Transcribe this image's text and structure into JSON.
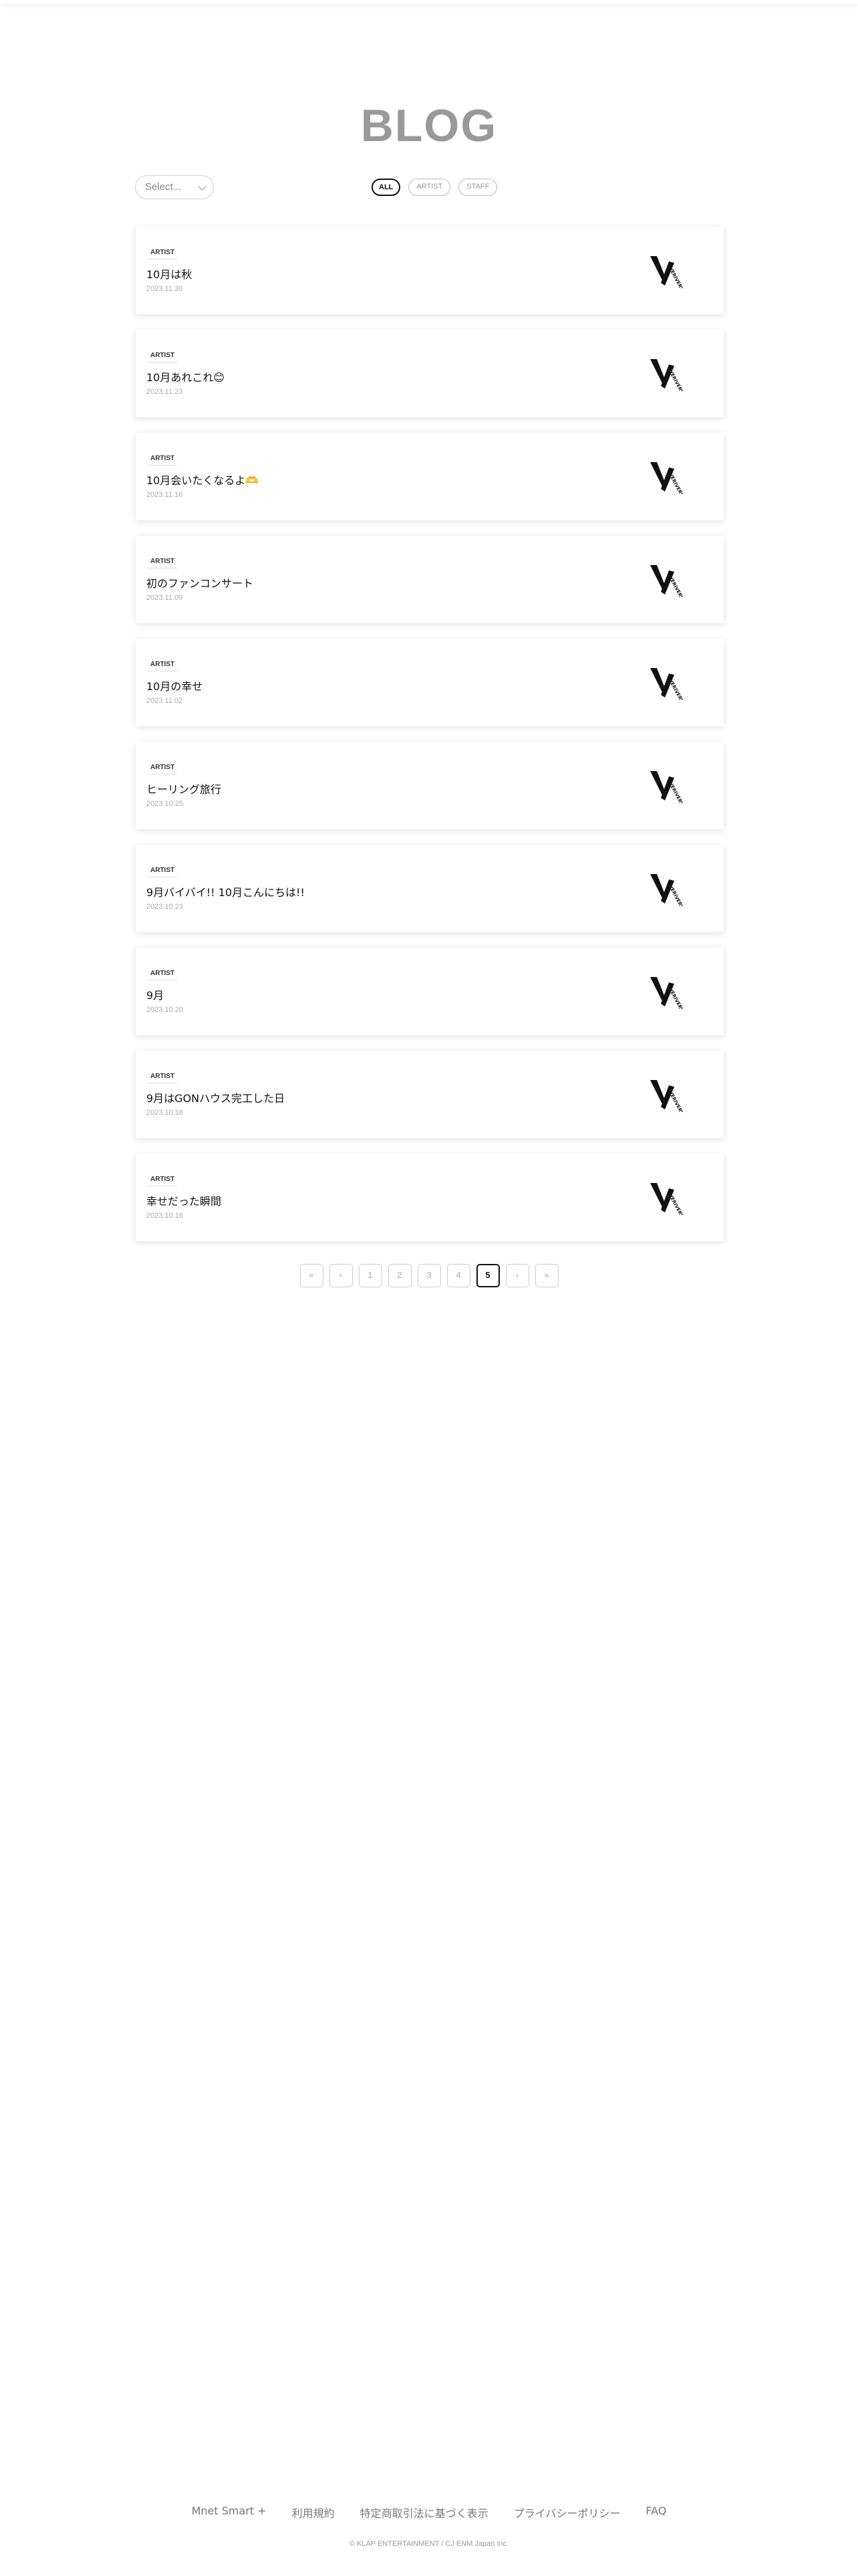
{
  "header": {
    "title": "BLOG"
  },
  "filter": {
    "select_placeholder": "Select...",
    "chips": [
      "ALL",
      "ARTIST",
      "STAFF"
    ],
    "active_chip": "ALL"
  },
  "posts": [
    {
      "tag": "ARTIST",
      "title": "10月は秋",
      "date": "2023.11.30"
    },
    {
      "tag": "ARTIST",
      "title": "10月あれこれ😊",
      "date": "2023.11.23"
    },
    {
      "tag": "ARTIST",
      "title": "10月会いたくなるよ🫶",
      "date": "2023.11.16"
    },
    {
      "tag": "ARTIST",
      "title": "初のファンコンサート",
      "date": "2023.11.09"
    },
    {
      "tag": "ARTIST",
      "title": "10月の幸せ",
      "date": "2023.11.02"
    },
    {
      "tag": "ARTIST",
      "title": "ヒーリング旅行",
      "date": "2023.10.25"
    },
    {
      "tag": "ARTIST",
      "title": "9月バイバイ!! 10月こんにちは!!",
      "date": "2023.10.23"
    },
    {
      "tag": "ARTIST",
      "title": "9月",
      "date": "2023.10.20"
    },
    {
      "tag": "ARTIST",
      "title": "9月はGONハウス完工した日",
      "date": "2023.10.18"
    },
    {
      "tag": "ARTIST",
      "title": "幸せだった瞬間",
      "date": "2023.10.16"
    }
  ],
  "post_logo_icon": "verivery-v-logo-icon",
  "pagination": {
    "first": "«",
    "prev": "‹",
    "pages": [
      "1",
      "2",
      "3",
      "4",
      "5"
    ],
    "current": "5",
    "next": "›",
    "last": "»"
  },
  "footer": {
    "links": [
      "Mnet Smart +",
      "利用規約",
      "特定商取引法に基づく表示",
      "プライバシーポリシー",
      "FAQ"
    ],
    "copyright": "© KLAP ENTERTAINMENT / CJ ENM Japan Inc."
  },
  "colors": {
    "title_gray": "#999999",
    "active_border": "#111111"
  }
}
